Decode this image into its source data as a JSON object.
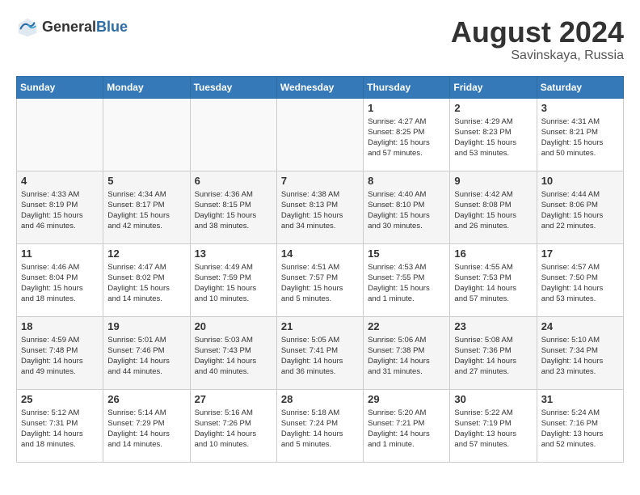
{
  "header": {
    "logo_line1": "General",
    "logo_line2": "Blue",
    "month_title": "August 2024",
    "subtitle": "Savinskaya, Russia"
  },
  "days_of_week": [
    "Sunday",
    "Monday",
    "Tuesday",
    "Wednesday",
    "Thursday",
    "Friday",
    "Saturday"
  ],
  "weeks": [
    [
      {
        "day": "",
        "info": ""
      },
      {
        "day": "",
        "info": ""
      },
      {
        "day": "",
        "info": ""
      },
      {
        "day": "",
        "info": ""
      },
      {
        "day": "1",
        "info": "Sunrise: 4:27 AM\nSunset: 8:25 PM\nDaylight: 15 hours\nand 57 minutes."
      },
      {
        "day": "2",
        "info": "Sunrise: 4:29 AM\nSunset: 8:23 PM\nDaylight: 15 hours\nand 53 minutes."
      },
      {
        "day": "3",
        "info": "Sunrise: 4:31 AM\nSunset: 8:21 PM\nDaylight: 15 hours\nand 50 minutes."
      }
    ],
    [
      {
        "day": "4",
        "info": "Sunrise: 4:33 AM\nSunset: 8:19 PM\nDaylight: 15 hours\nand 46 minutes."
      },
      {
        "day": "5",
        "info": "Sunrise: 4:34 AM\nSunset: 8:17 PM\nDaylight: 15 hours\nand 42 minutes."
      },
      {
        "day": "6",
        "info": "Sunrise: 4:36 AM\nSunset: 8:15 PM\nDaylight: 15 hours\nand 38 minutes."
      },
      {
        "day": "7",
        "info": "Sunrise: 4:38 AM\nSunset: 8:13 PM\nDaylight: 15 hours\nand 34 minutes."
      },
      {
        "day": "8",
        "info": "Sunrise: 4:40 AM\nSunset: 8:10 PM\nDaylight: 15 hours\nand 30 minutes."
      },
      {
        "day": "9",
        "info": "Sunrise: 4:42 AM\nSunset: 8:08 PM\nDaylight: 15 hours\nand 26 minutes."
      },
      {
        "day": "10",
        "info": "Sunrise: 4:44 AM\nSunset: 8:06 PM\nDaylight: 15 hours\nand 22 minutes."
      }
    ],
    [
      {
        "day": "11",
        "info": "Sunrise: 4:46 AM\nSunset: 8:04 PM\nDaylight: 15 hours\nand 18 minutes."
      },
      {
        "day": "12",
        "info": "Sunrise: 4:47 AM\nSunset: 8:02 PM\nDaylight: 15 hours\nand 14 minutes."
      },
      {
        "day": "13",
        "info": "Sunrise: 4:49 AM\nSunset: 7:59 PM\nDaylight: 15 hours\nand 10 minutes."
      },
      {
        "day": "14",
        "info": "Sunrise: 4:51 AM\nSunset: 7:57 PM\nDaylight: 15 hours\nand 5 minutes."
      },
      {
        "day": "15",
        "info": "Sunrise: 4:53 AM\nSunset: 7:55 PM\nDaylight: 15 hours\nand 1 minute."
      },
      {
        "day": "16",
        "info": "Sunrise: 4:55 AM\nSunset: 7:53 PM\nDaylight: 14 hours\nand 57 minutes."
      },
      {
        "day": "17",
        "info": "Sunrise: 4:57 AM\nSunset: 7:50 PM\nDaylight: 14 hours\nand 53 minutes."
      }
    ],
    [
      {
        "day": "18",
        "info": "Sunrise: 4:59 AM\nSunset: 7:48 PM\nDaylight: 14 hours\nand 49 minutes."
      },
      {
        "day": "19",
        "info": "Sunrise: 5:01 AM\nSunset: 7:46 PM\nDaylight: 14 hours\nand 44 minutes."
      },
      {
        "day": "20",
        "info": "Sunrise: 5:03 AM\nSunset: 7:43 PM\nDaylight: 14 hours\nand 40 minutes."
      },
      {
        "day": "21",
        "info": "Sunrise: 5:05 AM\nSunset: 7:41 PM\nDaylight: 14 hours\nand 36 minutes."
      },
      {
        "day": "22",
        "info": "Sunrise: 5:06 AM\nSunset: 7:38 PM\nDaylight: 14 hours\nand 31 minutes."
      },
      {
        "day": "23",
        "info": "Sunrise: 5:08 AM\nSunset: 7:36 PM\nDaylight: 14 hours\nand 27 minutes."
      },
      {
        "day": "24",
        "info": "Sunrise: 5:10 AM\nSunset: 7:34 PM\nDaylight: 14 hours\nand 23 minutes."
      }
    ],
    [
      {
        "day": "25",
        "info": "Sunrise: 5:12 AM\nSunset: 7:31 PM\nDaylight: 14 hours\nand 18 minutes."
      },
      {
        "day": "26",
        "info": "Sunrise: 5:14 AM\nSunset: 7:29 PM\nDaylight: 14 hours\nand 14 minutes."
      },
      {
        "day": "27",
        "info": "Sunrise: 5:16 AM\nSunset: 7:26 PM\nDaylight: 14 hours\nand 10 minutes."
      },
      {
        "day": "28",
        "info": "Sunrise: 5:18 AM\nSunset: 7:24 PM\nDaylight: 14 hours\nand 5 minutes."
      },
      {
        "day": "29",
        "info": "Sunrise: 5:20 AM\nSunset: 7:21 PM\nDaylight: 14 hours\nand 1 minute."
      },
      {
        "day": "30",
        "info": "Sunrise: 5:22 AM\nSunset: 7:19 PM\nDaylight: 13 hours\nand 57 minutes."
      },
      {
        "day": "31",
        "info": "Sunrise: 5:24 AM\nSunset: 7:16 PM\nDaylight: 13 hours\nand 52 minutes."
      }
    ]
  ]
}
